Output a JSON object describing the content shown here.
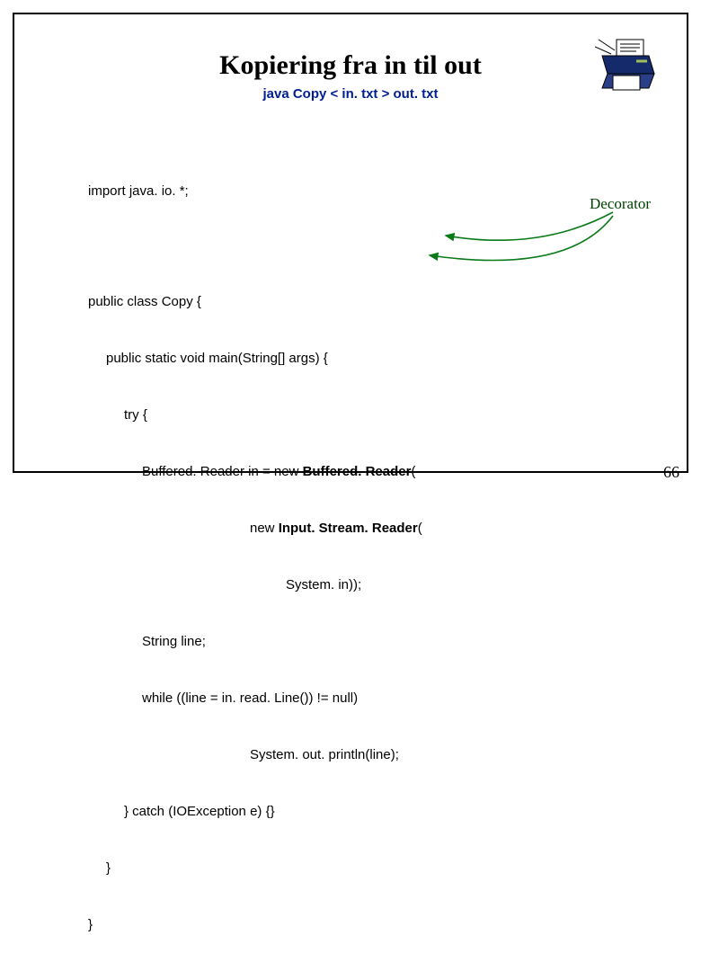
{
  "title": "Kopiering fra in til out",
  "subtitle": "java Copy < in. txt > out. txt",
  "code": {
    "c0": "import java. io. *;",
    "c1": "public class Copy {",
    "c2": "public static void main(String[] args) {",
    "c3": "try {",
    "c4a": "Buffered. Reader in = new ",
    "c4b": "Buffered. Reader",
    "c4c": "(",
    "c5a": "new ",
    "c5b": "Input. Stream. Reader",
    "c5c": "(",
    "c6": "System. in));",
    "c7": "String line;",
    "c8": "while ((line = in. read. Line()) != null)",
    "c9": "System. out. println(line);",
    "c10": "} catch (IOException e) {}",
    "c11": "}",
    "c12": "}"
  },
  "annotation": "Decorator",
  "pageNumber": "66"
}
